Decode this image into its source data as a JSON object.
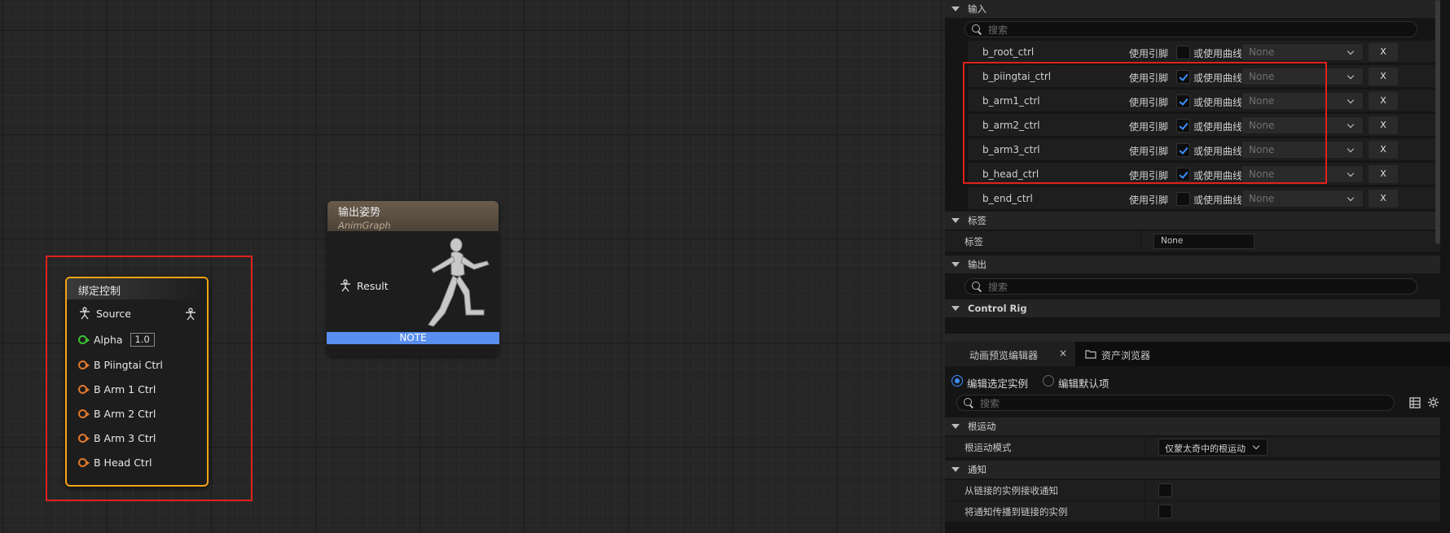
{
  "graph": {
    "bind_node": {
      "title": "绑定控制",
      "source_label": "Source",
      "alpha_label": "Alpha",
      "alpha_value": "1.0",
      "pins": [
        "B Piingtai Ctrl",
        "B Arm 1 Ctrl",
        "B Arm 2 Ctrl",
        "B Arm 3 Ctrl",
        "B Head Ctrl"
      ]
    },
    "output_node": {
      "title": "输出姿势",
      "subtitle": "AnimGraph",
      "result_label": "Result",
      "note": "NOTE"
    }
  },
  "details": {
    "input_category": "输入",
    "search_placeholder": "搜索",
    "use_pin_label": "使用引脚",
    "or_curve_label": "或使用曲线",
    "dropdown_value": "None",
    "clear_label": "X",
    "bones": [
      {
        "name": "b_root_ctrl",
        "checked": false
      },
      {
        "name": "b_piingtai_ctrl",
        "checked": true
      },
      {
        "name": "b_arm1_ctrl",
        "checked": true
      },
      {
        "name": "b_arm2_ctrl",
        "checked": true
      },
      {
        "name": "b_arm3_ctrl",
        "checked": true
      },
      {
        "name": "b_head_ctrl",
        "checked": true
      },
      {
        "name": "b_end_ctrl",
        "checked": false
      }
    ],
    "tag_category": "标签",
    "tag_label": "标签",
    "tag_value": "None",
    "output_category": "输出",
    "output_search_placeholder": "搜索",
    "control_rig_category": "Control Rig"
  },
  "preview": {
    "tabs": [
      {
        "label": "动画预览编辑器"
      },
      {
        "label": "资产浏览器"
      }
    ],
    "tab_close": "×",
    "radio_edit_instance": "编辑选定实例",
    "radio_edit_default": "编辑默认项",
    "search_placeholder": "搜索",
    "root_motion_category": "根运动",
    "root_motion_mode_label": "根运动模式",
    "root_motion_mode_value": "仅蒙太奇中的根运动",
    "notify_category": "通知",
    "notify_receive_label": "从链接的实例接收通知",
    "notify_propagate_label": "将通知传播到链接的实例"
  },
  "colors": {
    "node_border_selected": "#f5a416",
    "highlight_box": "#e0201c",
    "pin_orange": "#e0782a",
    "pin_green": "#39c232",
    "note_blue": "#5a8ff0",
    "check_blue": "#3b8eff"
  }
}
